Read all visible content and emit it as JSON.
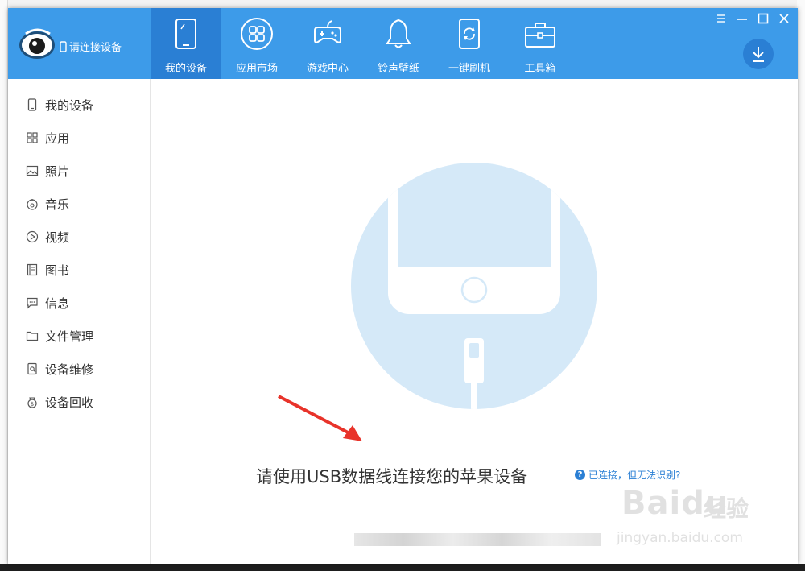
{
  "app": {
    "device_status": "请连接设备",
    "accent_color": "#3d9be9",
    "active_tab_color": "#2a7fd4"
  },
  "nav": {
    "items": [
      {
        "label": "我的设备",
        "icon": "tablet-icon",
        "active": true
      },
      {
        "label": "应用市场",
        "icon": "apps-grid-icon",
        "active": false
      },
      {
        "label": "游戏中心",
        "icon": "gamepad-icon",
        "active": false
      },
      {
        "label": "铃声壁纸",
        "icon": "bell-icon",
        "active": false
      },
      {
        "label": "一键刷机",
        "icon": "refresh-phone-icon",
        "active": false
      },
      {
        "label": "工具箱",
        "icon": "toolbox-icon",
        "active": false
      }
    ]
  },
  "window_controls": [
    "menu-icon",
    "minimize-icon",
    "maximize-icon",
    "close-icon"
  ],
  "sidebar": {
    "items": [
      {
        "label": "我的设备",
        "icon": "phone-icon"
      },
      {
        "label": "应用",
        "icon": "apps-icon"
      },
      {
        "label": "照片",
        "icon": "photo-icon"
      },
      {
        "label": "音乐",
        "icon": "music-icon"
      },
      {
        "label": "视频",
        "icon": "video-icon"
      },
      {
        "label": "图书",
        "icon": "book-icon"
      },
      {
        "label": "信息",
        "icon": "message-icon"
      },
      {
        "label": "文件管理",
        "icon": "folder-icon"
      },
      {
        "label": "设备维修",
        "icon": "repair-icon"
      },
      {
        "label": "设备回收",
        "icon": "recycle-icon"
      }
    ]
  },
  "main": {
    "connect_message": "请使用USB数据线连接您的苹果设备",
    "help_link": "已连接，但无法识别?"
  },
  "watermark": {
    "brand": "Baidu",
    "brand_cn": "经验",
    "url": "jingyan.baidu.com"
  }
}
